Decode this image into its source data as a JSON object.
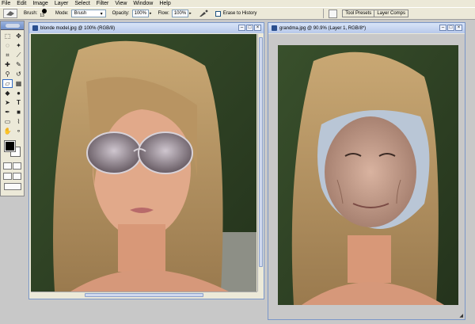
{
  "menu": [
    "File",
    "Edit",
    "Image",
    "Layer",
    "Select",
    "Filter",
    "View",
    "Window",
    "Help"
  ],
  "options": {
    "brush_label": "Brush:",
    "brush_size": "13",
    "mode_label": "Mode:",
    "mode_value": "Brush",
    "opacity_label": "Opacity:",
    "opacity_value": "100%",
    "flow_label": "Flow:",
    "flow_value": "100%",
    "erase_to_history": "Erase to History",
    "tabs": [
      "Tool Presets",
      "Layer Comps"
    ]
  },
  "windows": {
    "left_title": "blonde model.jpg @ 100% (RGB/8)",
    "right_title": "grandma.jpg @ 90.9% (Layer 1, RGB/8*)"
  },
  "icons": {
    "minimize": "minimize-icon",
    "maximize": "maximize-icon",
    "close": "close-icon"
  },
  "colors": {
    "foreground": "#000000",
    "background": "#ffffff",
    "workspace": "#c8c8c8",
    "chrome": "#ece9d8"
  }
}
